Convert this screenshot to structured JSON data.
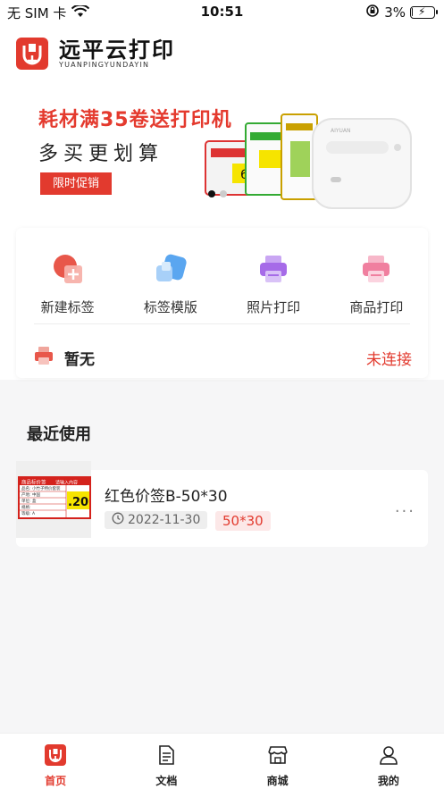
{
  "status_bar": {
    "carrier": "无 SIM 卡",
    "time": "10:51",
    "battery": "3%",
    "battery_level": 0.03
  },
  "header": {
    "logo_cn": "远平云打印",
    "logo_en": "YUANPINGYUNDAYIN"
  },
  "banner": {
    "title": "耗材满35卷送打印机",
    "subtitle": "多买更划算",
    "button": "限时促销",
    "label_number": "6",
    "printer_brand": "AIYUAN",
    "slide_count": 2,
    "active_slide": 1
  },
  "functions": [
    {
      "label": "新建标签",
      "icon": "new-label-icon"
    },
    {
      "label": "标签模版",
      "icon": "label-template-icon"
    },
    {
      "label": "照片打印",
      "icon": "photo-print-icon"
    },
    {
      "label": "商品打印",
      "icon": "product-print-icon"
    }
  ],
  "printer": {
    "name": "暂无",
    "status": "未连接"
  },
  "recent": {
    "title": "最近使用",
    "items": [
      {
        "name": "红色价签B-50*30",
        "date": "2022-11-30",
        "size": "50*30",
        "more": "···",
        "thumb_header": "商品标价签",
        "thumb_header_right": "请输入内容",
        "thumb_rows": [
          "品名: 小竹子特价套装",
          "产地: 中国",
          "单位: 盒",
          "规格:",
          "等级: A"
        ],
        "thumb_price": ".20"
      }
    ]
  },
  "tabbar": [
    {
      "label": "首页",
      "icon": "home-icon",
      "active": true
    },
    {
      "label": "文档",
      "icon": "document-icon",
      "active": false
    },
    {
      "label": "商城",
      "icon": "store-icon",
      "active": false
    },
    {
      "label": "我的",
      "icon": "user-icon",
      "active": false
    }
  ],
  "colors": {
    "accent": "#e23a2e",
    "background": "#f6f6f7"
  }
}
